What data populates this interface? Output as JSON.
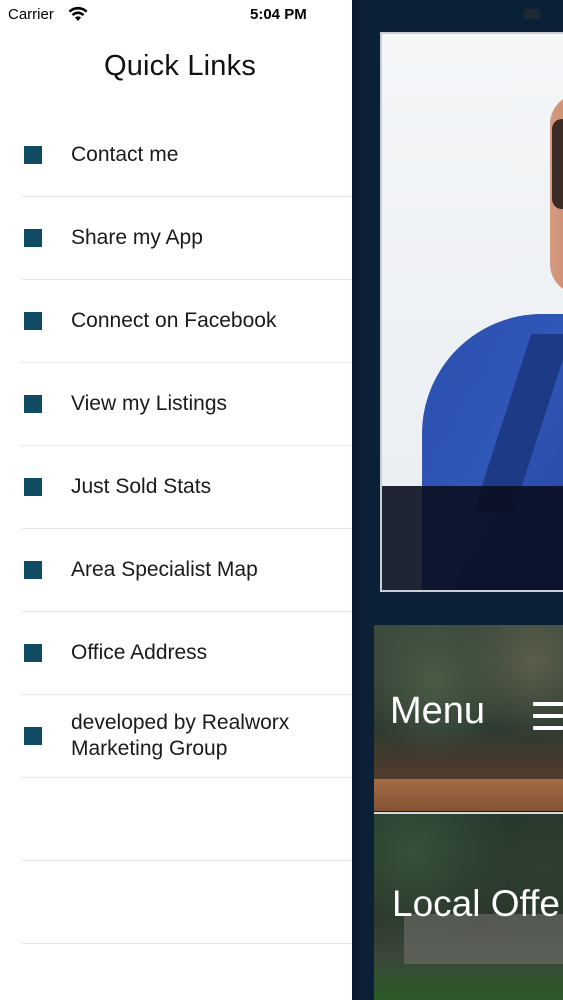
{
  "status_bar": {
    "carrier": "Carrier",
    "wifi_icon": "wifi-icon",
    "time": "5:04 PM"
  },
  "drawer": {
    "title": "Quick Links",
    "bullet_color": "#0f4b63",
    "items": [
      {
        "label": "Contact me",
        "icon": "square-bullet-icon"
      },
      {
        "label": "Share my App",
        "icon": "square-bullet-icon"
      },
      {
        "label": "Connect on Facebook",
        "icon": "square-bullet-icon"
      },
      {
        "label": "View my Listings",
        "icon": "square-bullet-icon"
      },
      {
        "label": "Just Sold Stats",
        "icon": "square-bullet-icon"
      },
      {
        "label": "Area Specialist Map",
        "icon": "square-bullet-icon"
      },
      {
        "label": "Office Address",
        "icon": "square-bullet-icon"
      },
      {
        "label": "developed by Realworx Marketing Group",
        "icon": "square-bullet-icon"
      }
    ]
  },
  "main": {
    "background_color": "#0b1f36",
    "menu_tile": {
      "label": "Menu",
      "icon": "hamburger-icon"
    },
    "office_tile": {
      "label": "Local Offe"
    }
  }
}
